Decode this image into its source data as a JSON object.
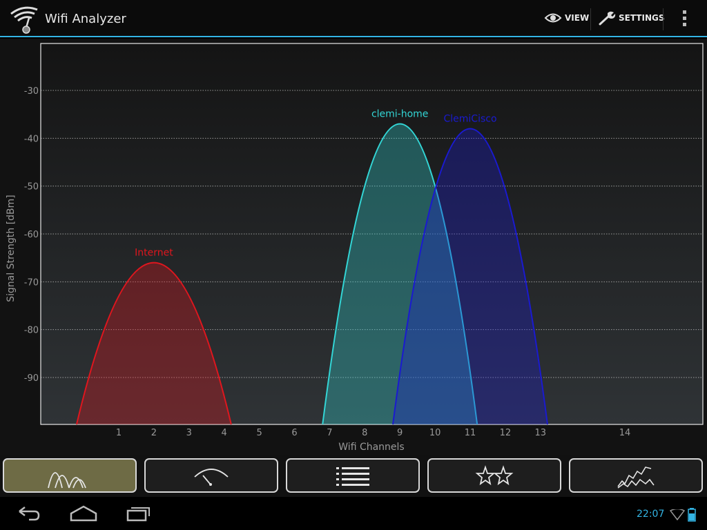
{
  "app": {
    "title": "Wifi Analyzer"
  },
  "action_bar": {
    "view_label": "VIEW",
    "settings_label": "SETTINGS"
  },
  "chart_data": {
    "type": "area",
    "xlabel": "Wifi Channels",
    "ylabel": "Signal Strength [dBm]",
    "x_ticks": [
      1,
      2,
      3,
      4,
      5,
      6,
      7,
      8,
      9,
      10,
      11,
      12,
      13,
      14
    ],
    "y_ticks": [
      -30,
      -40,
      -50,
      -60,
      -70,
      -80,
      -90
    ],
    "ylim": [
      -100,
      -20
    ],
    "grid": true,
    "series": [
      {
        "name": "Internet",
        "channel": 2,
        "signal_dbm": -66,
        "color": "#e0161e"
      },
      {
        "name": "clemi-home",
        "channel": 9,
        "signal_dbm": -37,
        "color": "#33d6d6"
      },
      {
        "name": "ClemiCisco",
        "channel": 11,
        "signal_dbm": -38,
        "color": "#1a1ad0"
      }
    ]
  },
  "tabs": [
    {
      "icon": "channel-graph-icon",
      "active": true
    },
    {
      "icon": "signal-meter-icon",
      "active": false
    },
    {
      "icon": "ap-list-icon",
      "active": false
    },
    {
      "icon": "channel-rating-icon",
      "active": false
    },
    {
      "icon": "time-graph-icon",
      "active": false
    }
  ],
  "status_bar": {
    "time": "22:07"
  },
  "colors": {
    "accent": "#33b5e5",
    "tab_active": "#6e6b45"
  }
}
